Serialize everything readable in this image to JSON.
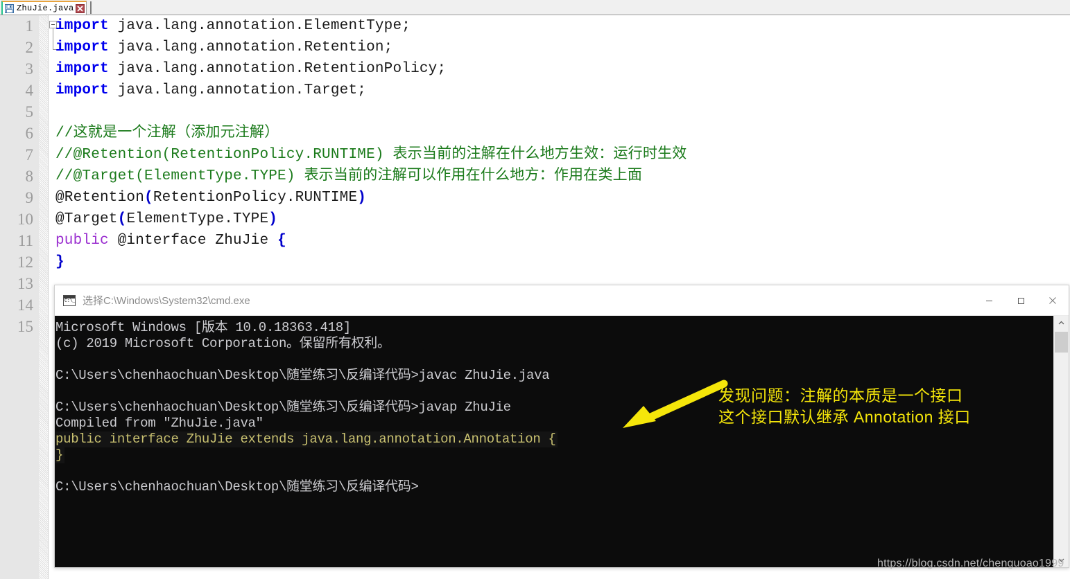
{
  "editor": {
    "tab": {
      "label": "ZhuJie.java",
      "save_icon": "floppy-disk-icon",
      "close_icon": "close-x-icon"
    },
    "line_numbers": [
      "1",
      "2",
      "3",
      "4",
      "5",
      "6",
      "7",
      "8",
      "9",
      "10",
      "11",
      "12",
      "13",
      "14",
      "15"
    ],
    "code_lines": [
      {
        "n": "1",
        "tokens": [
          {
            "t": "import",
            "c": "kw"
          },
          {
            "t": " java.lang.annotation.ElementType;",
            "c": "plain"
          }
        ]
      },
      {
        "n": "2",
        "tokens": [
          {
            "t": "import",
            "c": "kw"
          },
          {
            "t": " java.lang.annotation.Retention;",
            "c": "plain"
          }
        ]
      },
      {
        "n": "3",
        "tokens": [
          {
            "t": "import",
            "c": "kw"
          },
          {
            "t": " java.lang.annotation.RetentionPolicy;",
            "c": "plain"
          }
        ]
      },
      {
        "n": "4",
        "tokens": [
          {
            "t": "import",
            "c": "kw"
          },
          {
            "t": " java.lang.annotation.Target;",
            "c": "plain"
          }
        ]
      },
      {
        "n": "5",
        "tokens": []
      },
      {
        "n": "6",
        "tokens": [
          {
            "t": "//这就是一个注解（添加元注解）",
            "c": "cmt"
          }
        ]
      },
      {
        "n": "7",
        "tokens": [
          {
            "t": "//@Retention(RetentionPolicy.RUNTIME) 表示当前的注解在什么地方生效：运行时生效",
            "c": "cmt"
          }
        ]
      },
      {
        "n": "8",
        "tokens": [
          {
            "t": "//@Target(ElementType.TYPE) 表示当前的注解可以作用在什么地方：作用在类上面",
            "c": "cmt"
          }
        ]
      },
      {
        "n": "9",
        "tokens": [
          {
            "t": "@Retention",
            "c": "plain"
          },
          {
            "t": "(",
            "c": "punc"
          },
          {
            "t": "RetentionPolicy.RUNTIME",
            "c": "plain"
          },
          {
            "t": ")",
            "c": "punc"
          }
        ]
      },
      {
        "n": "10",
        "tokens": [
          {
            "t": "@Target",
            "c": "plain"
          },
          {
            "t": "(",
            "c": "punc"
          },
          {
            "t": "ElementType.TYPE",
            "c": "plain"
          },
          {
            "t": ")",
            "c": "punc"
          }
        ]
      },
      {
        "n": "11",
        "tokens": [
          {
            "t": "public",
            "c": "kw-pub"
          },
          {
            "t": " @interface ZhuJie ",
            "c": "plain"
          },
          {
            "t": "{",
            "c": "punc"
          }
        ]
      },
      {
        "n": "12",
        "tokens": [
          {
            "t": "}",
            "c": "punc"
          }
        ]
      },
      {
        "n": "13",
        "tokens": []
      },
      {
        "n": "14",
        "tokens": []
      },
      {
        "n": "15",
        "tokens": []
      }
    ]
  },
  "cmd_window": {
    "title": "选择C:\\Windows\\System32\\cmd.exe",
    "icon_text": "C:\\_",
    "controls": {
      "minimize": "minimize-icon",
      "maximize": "maximize-icon",
      "close": "close-icon"
    },
    "console_lines": [
      {
        "text": "Microsoft Windows [版本 10.0.18363.418]",
        "selected": false
      },
      {
        "text": "(c) 2019 Microsoft Corporation。保留所有权利。",
        "selected": false
      },
      {
        "text": "",
        "selected": false
      },
      {
        "text": "C:\\Users\\chenhaochuan\\Desktop\\随堂练习\\反编译代码>javac ZhuJie.java",
        "selected": false
      },
      {
        "text": "",
        "selected": false
      },
      {
        "text": "C:\\Users\\chenhaochuan\\Desktop\\随堂练习\\反编译代码>javap ZhuJie",
        "selected": false
      },
      {
        "text": "Compiled from \"ZhuJie.java\"",
        "selected": false
      },
      {
        "text": "public interface ZhuJie extends java.lang.annotation.Annotation {",
        "selected": true
      },
      {
        "text": "}",
        "selected": true
      },
      {
        "text": "",
        "selected": false
      },
      {
        "text": "C:\\Users\\chenhaochuan\\Desktop\\随堂练习\\反编译代码>",
        "selected": false
      }
    ],
    "scrollbar": {
      "up_icon": "chevron-up-icon",
      "down_icon": "chevron-down-icon"
    }
  },
  "annotation": {
    "arrow_icon": "arrow-down-left-icon",
    "lines": [
      "发现问题：注解的本质是一个接口",
      "这个接口默认继承 Annotation 接口"
    ],
    "color": "#f5e60a"
  },
  "watermark": {
    "text": "https://blog.csdn.net/chenguoao1999"
  },
  "colors": {
    "keyword": "#0000ee",
    "comment": "#1a7a1a",
    "public_keyword": "#9b30d0",
    "punctuation": "#0000cc",
    "console_bg": "#0c0c0c",
    "console_fg": "#ccccd0",
    "selection_fg": "#c8c070",
    "accent_yellow": "#f5e60a"
  }
}
